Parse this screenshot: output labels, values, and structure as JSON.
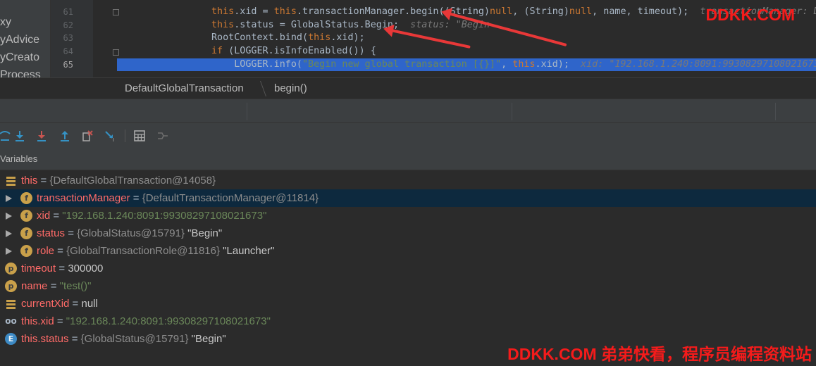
{
  "project_panel": {
    "items": [
      "xy",
      "yAdvice",
      "yCreato",
      "Process"
    ]
  },
  "editor": {
    "line_numbers": [
      "61",
      "62",
      "63",
      "64",
      "65"
    ],
    "lines": [
      {
        "tokens": [
          {
            "t": "this",
            "c": "kw"
          },
          {
            "t": ".xid = ",
            "c": ""
          },
          {
            "t": "this",
            "c": "kw"
          },
          {
            "t": ".transactionManager.begin((String)",
            "c": ""
          },
          {
            "t": "null",
            "c": "kw"
          },
          {
            "t": ", (String)",
            "c": ""
          },
          {
            "t": "null",
            "c": "kw"
          },
          {
            "t": ", name, timeout);",
            "c": ""
          },
          {
            "t": "  transactionManager: D",
            "c": "inl"
          }
        ]
      },
      {
        "tokens": [
          {
            "t": "this",
            "c": "kw"
          },
          {
            "t": ".status = GlobalStatus.Begin;",
            "c": ""
          },
          {
            "t": "  status: \"Begin",
            "c": "inl"
          }
        ]
      },
      {
        "tokens": [
          {
            "t": "RootContext.bind(",
            "c": ""
          },
          {
            "t": "this",
            "c": "kw"
          },
          {
            "t": ".xid);",
            "c": ""
          }
        ]
      },
      {
        "tokens": [
          {
            "t": "if",
            "c": "kw"
          },
          {
            "t": " (LOGGER.isInfoEnabled()) {",
            "c": ""
          }
        ]
      },
      {
        "tokens": [
          {
            "t": "    LOGGER.info(",
            "c": ""
          },
          {
            "t": "\"Begin new global transaction [{}]\"",
            "c": "str"
          },
          {
            "t": ", ",
            "c": ""
          },
          {
            "t": "this",
            "c": "kw"
          },
          {
            "t": ".xid);",
            "c": ""
          },
          {
            "t": "  xid: \"192.168.1.240:8091:99308297108021673",
            "c": "inl"
          }
        ]
      }
    ],
    "selected_line": "65",
    "watermark": "DDKK.COM"
  },
  "breadcrumb": {
    "items": [
      "DefaultGlobalTransaction",
      "begin()"
    ]
  },
  "toolbar": {
    "buttons": [
      {
        "name": "step-over-icon",
        "color": "#3592c4"
      },
      {
        "name": "step-into-icon",
        "color": "#3592c4"
      },
      {
        "name": "force-step-into-icon",
        "color": "#c75450"
      },
      {
        "name": "step-out-icon",
        "color": "#3592c4"
      },
      {
        "name": "drop-frame-icon",
        "color": "#c75450"
      },
      {
        "name": "run-to-cursor-icon",
        "color": "#3592c4"
      },
      {
        "name": "evaluate-expression-icon",
        "color": "#a9a9a9"
      },
      {
        "name": "trace-current-stream-icon",
        "color": "#6e6e6e"
      }
    ]
  },
  "variables_panel": {
    "title": "Variables",
    "rows": [
      {
        "icon": "stack",
        "name": "this",
        "eq": " = ",
        "ref": "{DefaultGlobalTransaction@14058}",
        "value": "",
        "value_kind": "plain",
        "expandable": false,
        "indent": 0,
        "selected": false
      },
      {
        "icon": "f",
        "name": "transactionManager",
        "eq": " = ",
        "ref": "{DefaultTransactionManager@11814}",
        "value": "",
        "value_kind": "plain",
        "expandable": true,
        "indent": 1,
        "selected": true
      },
      {
        "icon": "f",
        "name": "xid",
        "eq": " = ",
        "ref": "",
        "value": "\"192.168.1.240:8091:99308297108021673\"",
        "value_kind": "str",
        "expandable": true,
        "indent": 1,
        "selected": false
      },
      {
        "icon": "f",
        "name": "status",
        "eq": " = ",
        "ref": "{GlobalStatus@15791}",
        "value": " \"Begin\"",
        "value_kind": "plain",
        "expandable": true,
        "indent": 1,
        "selected": false
      },
      {
        "icon": "f",
        "name": "role",
        "eq": " = ",
        "ref": "{GlobalTransactionRole@11816}",
        "value": " \"Launcher\"",
        "value_kind": "plain",
        "expandable": true,
        "indent": 1,
        "selected": false
      },
      {
        "icon": "p",
        "name": "timeout",
        "eq": " = ",
        "ref": "",
        "value": "300000",
        "value_kind": "plain",
        "expandable": false,
        "indent": 0,
        "selected": false
      },
      {
        "icon": "p",
        "name": "name",
        "eq": " = ",
        "ref": "",
        "value": "\"test()\"",
        "value_kind": "str",
        "expandable": false,
        "indent": 0,
        "selected": false
      },
      {
        "icon": "stack",
        "name": "currentXid",
        "eq": " = ",
        "ref": "",
        "value": "null",
        "value_kind": "plain",
        "expandable": false,
        "indent": 0,
        "selected": false
      },
      {
        "icon": "glasses",
        "name": "this.xid",
        "eq": " = ",
        "ref": "",
        "value": "\"192.168.1.240:8091:99308297108021673\"",
        "value_kind": "str",
        "expandable": false,
        "indent": 0,
        "selected": false
      },
      {
        "icon": "e",
        "name": "this.status",
        "eq": " = ",
        "ref": "{GlobalStatus@15791}",
        "value": " \"Begin\"",
        "value_kind": "plain",
        "expandable": false,
        "indent": 0,
        "selected": false
      }
    ]
  },
  "watermark_bottom": "DDKK.COM 弟弟快看，程序员编程资料站"
}
